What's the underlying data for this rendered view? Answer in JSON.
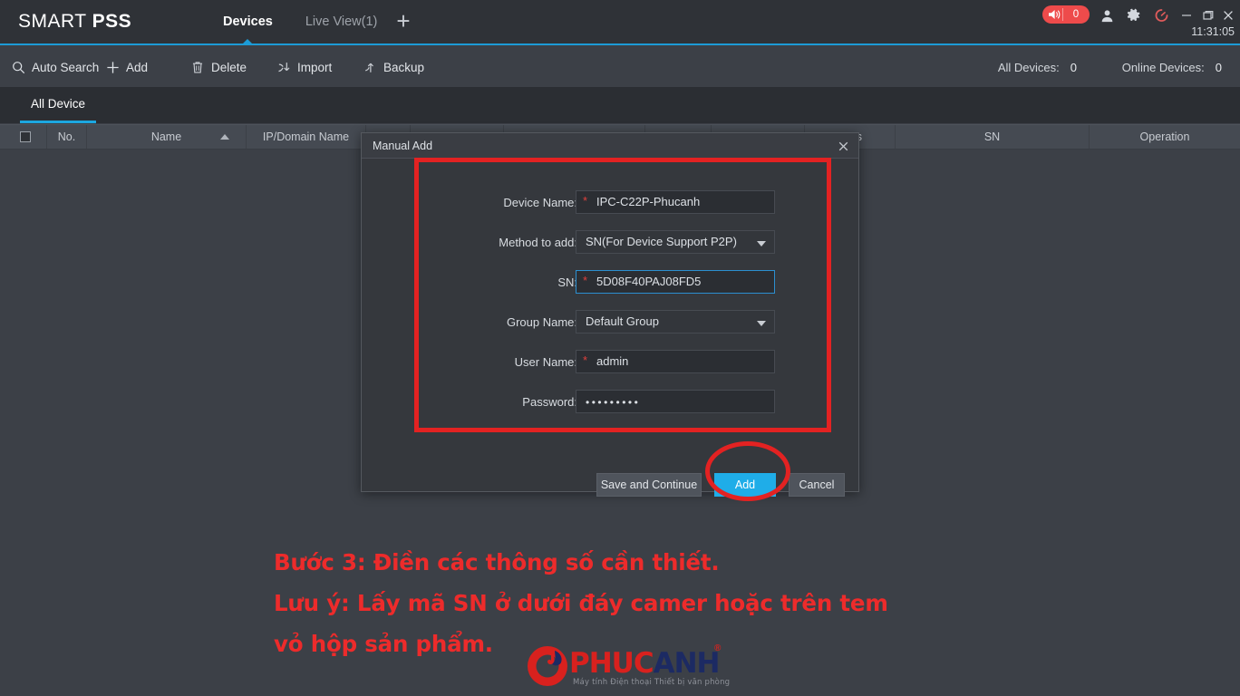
{
  "window": {
    "brand_light": "SMART ",
    "brand_bold": "PSS",
    "clock": "11:31:05",
    "nav_tabs": [
      {
        "label": "Devices",
        "active": true
      },
      {
        "label": "Live View(1)",
        "active": false
      }
    ],
    "add_tab_icon": "plus-icon",
    "alarm": {
      "icon": "speaker-icon",
      "count": "0"
    },
    "icons": {
      "user": "user-icon",
      "settings": "gear-icon",
      "gauge": "gauge-icon",
      "minimize": "minimize-icon",
      "maximize": "maximize-icon",
      "close": "close-icon"
    }
  },
  "toolbar": {
    "auto_search": "Auto Search",
    "add": "Add",
    "delete": "Delete",
    "import": "Import",
    "backup": "Backup",
    "all_devices_label": "All Devices:",
    "all_devices_count": "0",
    "online_devices_label": "Online Devices:",
    "online_devices_count": "0"
  },
  "device_tab": {
    "label": "All Device"
  },
  "table": {
    "columns": [
      {
        "key": "no",
        "label": "No."
      },
      {
        "key": "name",
        "label": "Name",
        "sorted": "asc"
      },
      {
        "key": "ip",
        "label": "IP/Domain Name"
      },
      {
        "key": "status",
        "label": "tatus"
      },
      {
        "key": "sn",
        "label": "SN"
      },
      {
        "key": "operation",
        "label": "Operation"
      }
    ],
    "rows": []
  },
  "modal": {
    "title": "Manual Add",
    "close_icon": "close-icon",
    "fields": {
      "device_name": {
        "label": "Device Name:",
        "value": "IPC-C22P-Phucanh",
        "required": true
      },
      "method_to_add": {
        "label": "Method to add:",
        "value": "SN(For Device Support P2P)"
      },
      "sn": {
        "label": "SN:",
        "value": "5D08F40PAJ08FD5",
        "required": true,
        "focused": true
      },
      "group_name": {
        "label": "Group Name:",
        "value": "Default Group"
      },
      "user_name": {
        "label": "User Name:",
        "value": "admin",
        "required": true
      },
      "password": {
        "label": "Password:",
        "value": "•••••••••"
      }
    },
    "buttons": {
      "save_and_continue": "Save and Continue",
      "add": "Add",
      "cancel": "Cancel"
    }
  },
  "annotation": {
    "line1": "Bước 3: Điền các thông số cần thiết.",
    "line2": "Lưu ý: Lấy mã SN ở dưới đáy camer hoặc trên tem",
    "line3": "vỏ hộp sản phẩm.",
    "color": "#ED2B2B"
  },
  "logo": {
    "part1": "PHUC",
    "part2": "ANH",
    "registered": "®",
    "tagline": "Máy tính  Điện thoại  Thiết bị văn phòng",
    "mark_icon": "phucanh-a-mark-icon"
  }
}
